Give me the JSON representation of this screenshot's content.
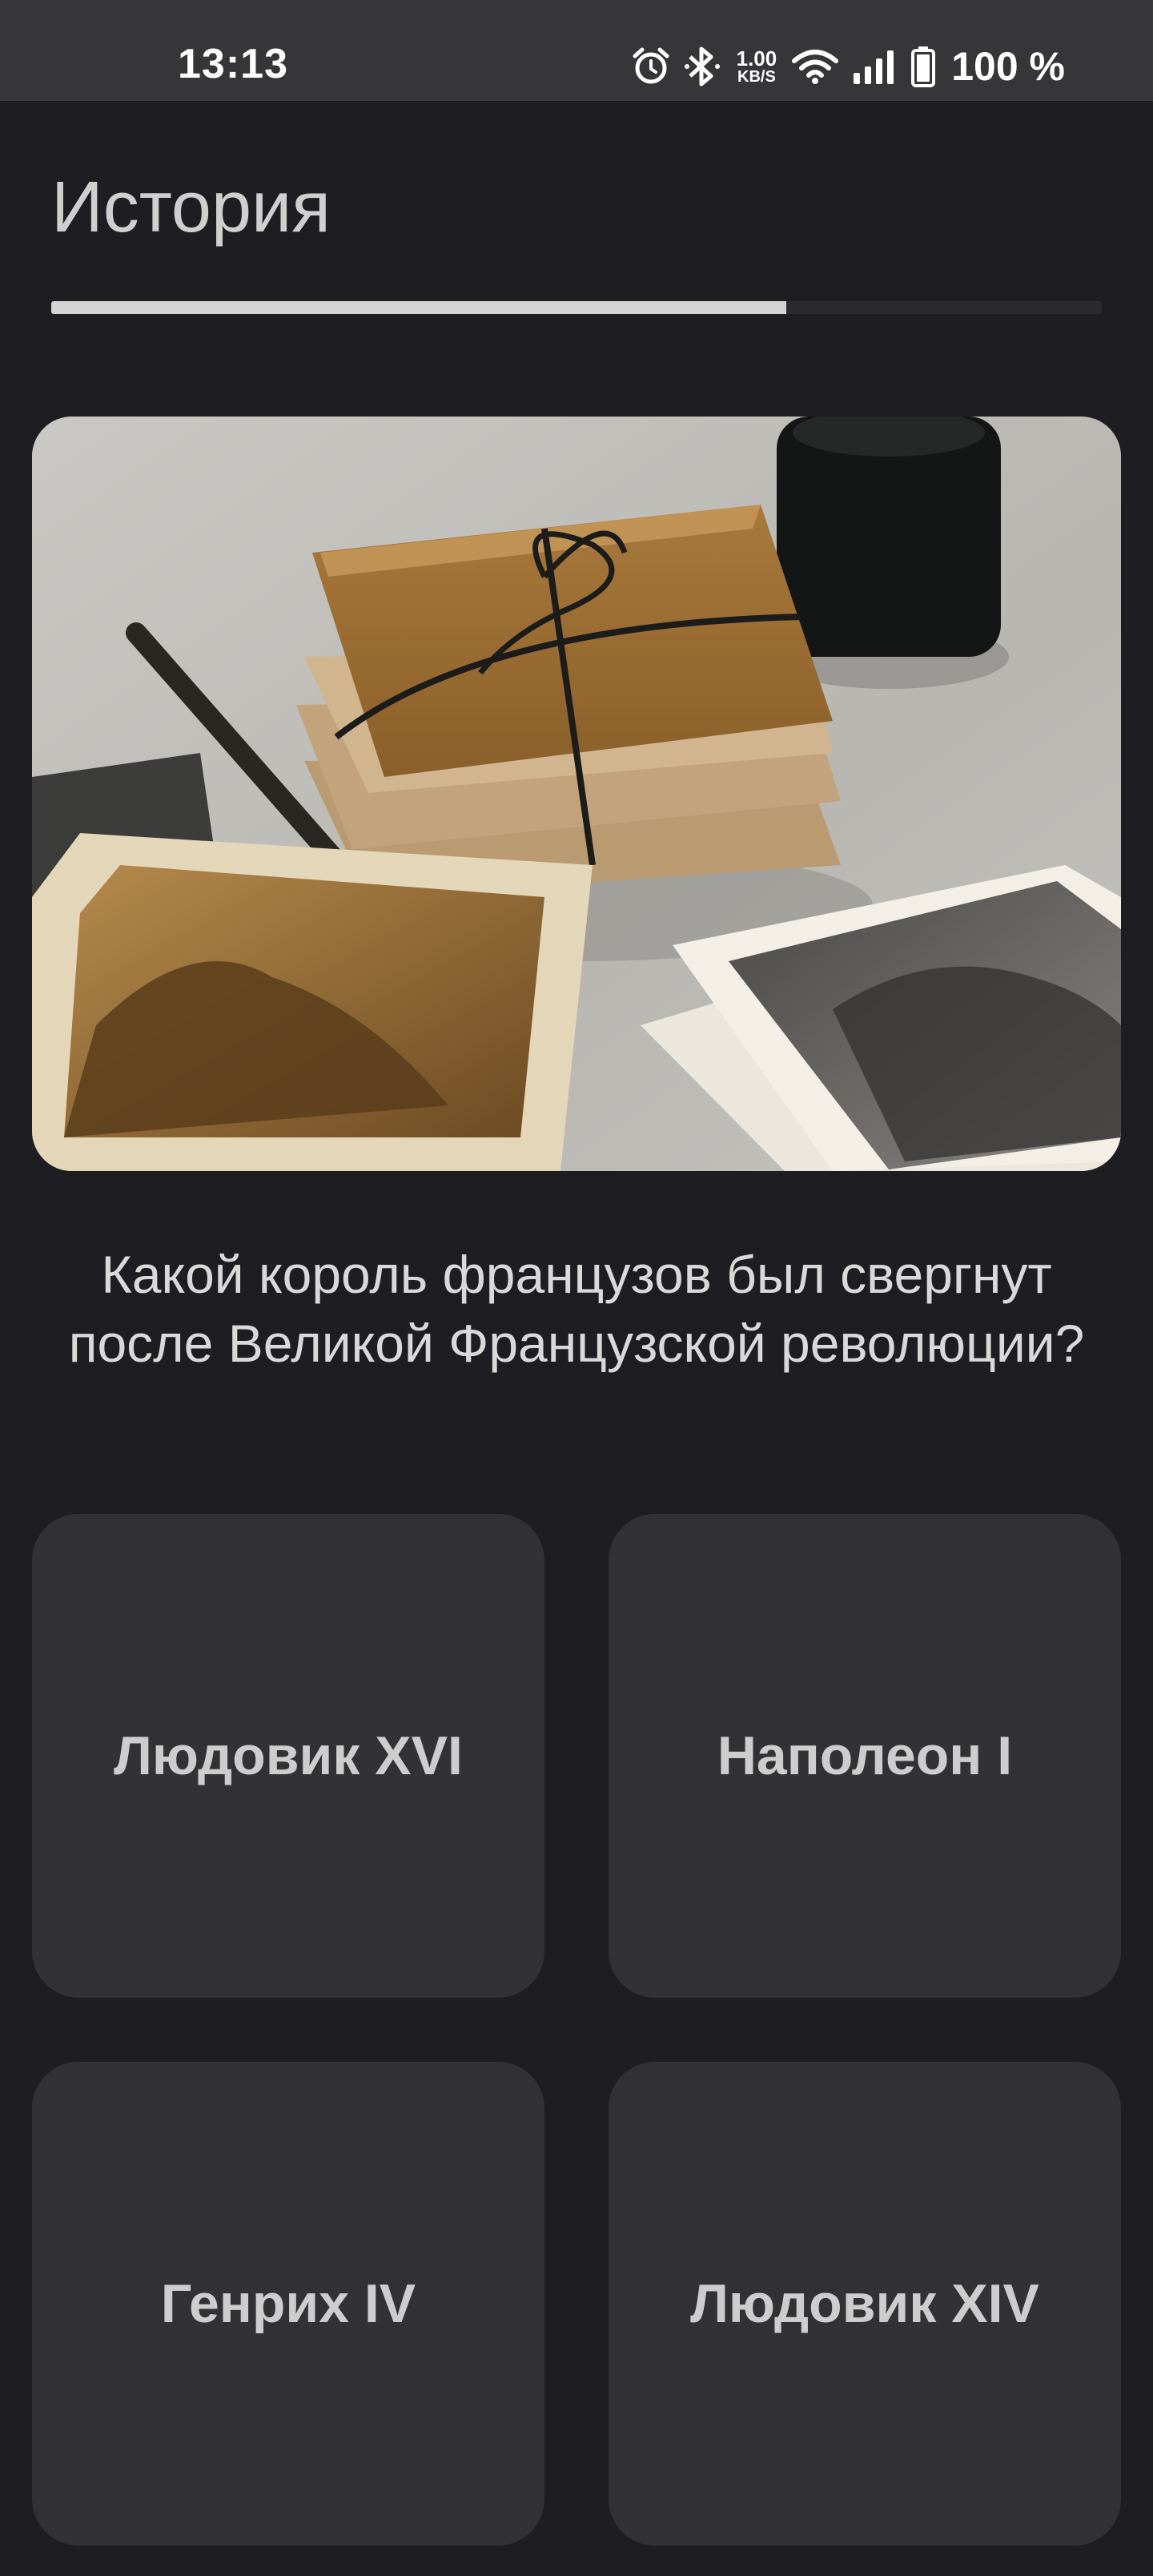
{
  "status_bar": {
    "time": "13:13",
    "net_speed_value": "1.00",
    "net_speed_unit": "KB/S",
    "battery": "100 %",
    "icons": [
      "alarm-icon",
      "bluetooth-icon",
      "wifi-icon",
      "signal-icon",
      "battery-icon"
    ]
  },
  "quiz": {
    "category": "История",
    "progress": 0.7,
    "image_icon": "vintage-letters-photo",
    "question": "Какой король французов был свергнут после Великой Французской революции?",
    "answers": [
      {
        "label": "Людовик XVI"
      },
      {
        "label": "Наполеон I"
      },
      {
        "label": "Генрих IV"
      },
      {
        "label": "Людовик XIV"
      }
    ]
  },
  "colors": {
    "background": "#1e1d21",
    "status_bar": "#363638",
    "answer_card": "#323234",
    "progress_fill": "#d4d4d4",
    "progress_track": "#2b2b2e"
  }
}
